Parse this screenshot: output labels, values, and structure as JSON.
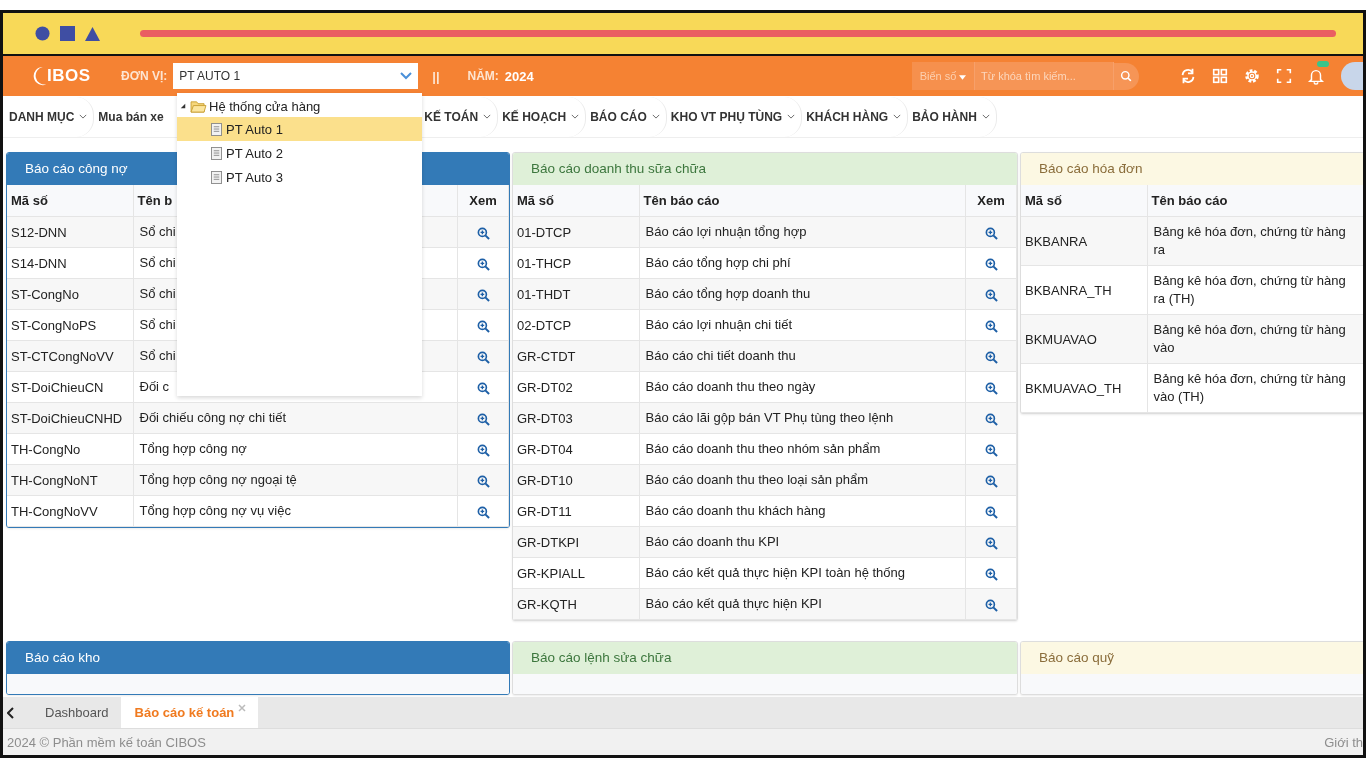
{
  "header": {
    "logo": "IBOS",
    "unit_label": "ĐƠN VỊ:",
    "unit_select": {
      "value": "PT AUTO 1"
    },
    "separator": "||",
    "year_label": "NĂM:",
    "year": "2024",
    "plate_filter": "Biển số",
    "search": {
      "placeholder": "Từ khóa tìm kiếm..."
    }
  },
  "unit_dropdown": {
    "tree": [
      {
        "label": "Hệ thống cửa hàng",
        "expanded": true,
        "children": [
          {
            "label": "PT Auto 1",
            "selected": true
          },
          {
            "label": "PT Auto 2",
            "selected": false
          },
          {
            "label": "PT Auto 3",
            "selected": false
          }
        ]
      }
    ]
  },
  "menu": [
    "DANH MỤC",
    "Mua bán xe",
    "KẾ TOÁN",
    "KẾ HOẠCH",
    "BÁO CÁO",
    "KHO VT PHỤ TÙNG",
    "KHÁCH HÀNG",
    "BẢO HÀNH"
  ],
  "panels": [
    {
      "title": "Báo cáo công nợ",
      "kind": "primary",
      "columns": [
        "Mã số",
        "Tên b",
        "Xem"
      ],
      "rows": [
        {
          "code": "S12-DNN",
          "name": "Sổ chi"
        },
        {
          "code": "S14-DNN",
          "name": "Sổ chi"
        },
        {
          "code": "ST-CongNo",
          "name": "Sổ chi"
        },
        {
          "code": "ST-CongNoPS",
          "name": "Sổ chi"
        },
        {
          "code": "ST-CTCongNoVV",
          "name": "Sổ chi"
        },
        {
          "code": "ST-DoiChieuCN",
          "name": "Đối c"
        },
        {
          "code": "ST-DoiChieuCNHD",
          "name": "Đối chiếu công nợ chi tiết"
        },
        {
          "code": "TH-CongNo",
          "name": "Tổng hợp công nợ"
        },
        {
          "code": "TH-CongNoNT",
          "name": "Tổng hợp công nợ ngoại tệ"
        },
        {
          "code": "TH-CongNoVV",
          "name": "Tổng hợp công nợ vụ việc"
        }
      ]
    },
    {
      "title": "Báo cáo doanh thu sữa chữa",
      "kind": "success",
      "columns": [
        "Mã số",
        "Tên báo cáo",
        "Xem"
      ],
      "rows": [
        {
          "code": "01-DTCP",
          "name": "Báo cáo lợi nhuận tổng hợp"
        },
        {
          "code": "01-THCP",
          "name": "Báo cáo tổng hợp chi phí"
        },
        {
          "code": "01-THDT",
          "name": "Báo cáo tổng hợp doanh thu"
        },
        {
          "code": "02-DTCP",
          "name": "Báo cáo lợi nhuận chi tiết"
        },
        {
          "code": "GR-CTDT",
          "name": "Báo cáo chi tiết doanh thu"
        },
        {
          "code": "GR-DT02",
          "name": "Báo cáo doanh thu theo ngày"
        },
        {
          "code": "GR-DT03",
          "name": "Báo cáo lãi gộp bán VT Phụ tùng theo lệnh"
        },
        {
          "code": "GR-DT04",
          "name": "Báo cáo doanh thu theo nhóm sản phẩm"
        },
        {
          "code": "GR-DT10",
          "name": "Báo cáo doanh thu theo loại sản phẩm"
        },
        {
          "code": "GR-DT11",
          "name": "Báo cáo doanh thu khách hàng"
        },
        {
          "code": "GR-DTKPI",
          "name": "Báo cáo doanh thu KPI"
        },
        {
          "code": "GR-KPIALL",
          "name": "Báo cáo kết quả thực hiện KPI toàn hệ thống"
        },
        {
          "code": "GR-KQTH",
          "name": "Báo cáo kết quả thực hiện KPI"
        }
      ]
    },
    {
      "title": "Báo cáo hóa đơn",
      "kind": "warning",
      "columns": [
        "Mã số",
        "Tên báo cáo"
      ],
      "rows": [
        {
          "code": "BKBANRA",
          "name": "Bảng kê hóa đơn, chứng từ hàng\nra"
        },
        {
          "code": "BKBANRA_TH",
          "name": "Bảng kê hóa đơn, chứng từ hàng\nra (TH)"
        },
        {
          "code": "BKMUAVAO",
          "name": "Bảng kê hóa đơn, chứng từ hàng\nvào"
        },
        {
          "code": "BKMUAVAO_TH",
          "name": "Bảng kê hóa đơn, chứng từ hàng\nvào (TH)"
        }
      ]
    },
    {
      "title": "Báo cáo kho",
      "kind": "primary"
    },
    {
      "title": "Báo cáo lệnh sửa chữa",
      "kind": "success"
    },
    {
      "title": "Báo cáo quỹ",
      "kind": "warning"
    }
  ],
  "bottom_tabs": [
    {
      "label": "Dashboard",
      "selected": false
    },
    {
      "label": "Báo cáo kế toán",
      "selected": true
    }
  ],
  "footer": {
    "copyright": "2024 © Phần mềm kế toán CIBOS",
    "link": "Giới th"
  }
}
